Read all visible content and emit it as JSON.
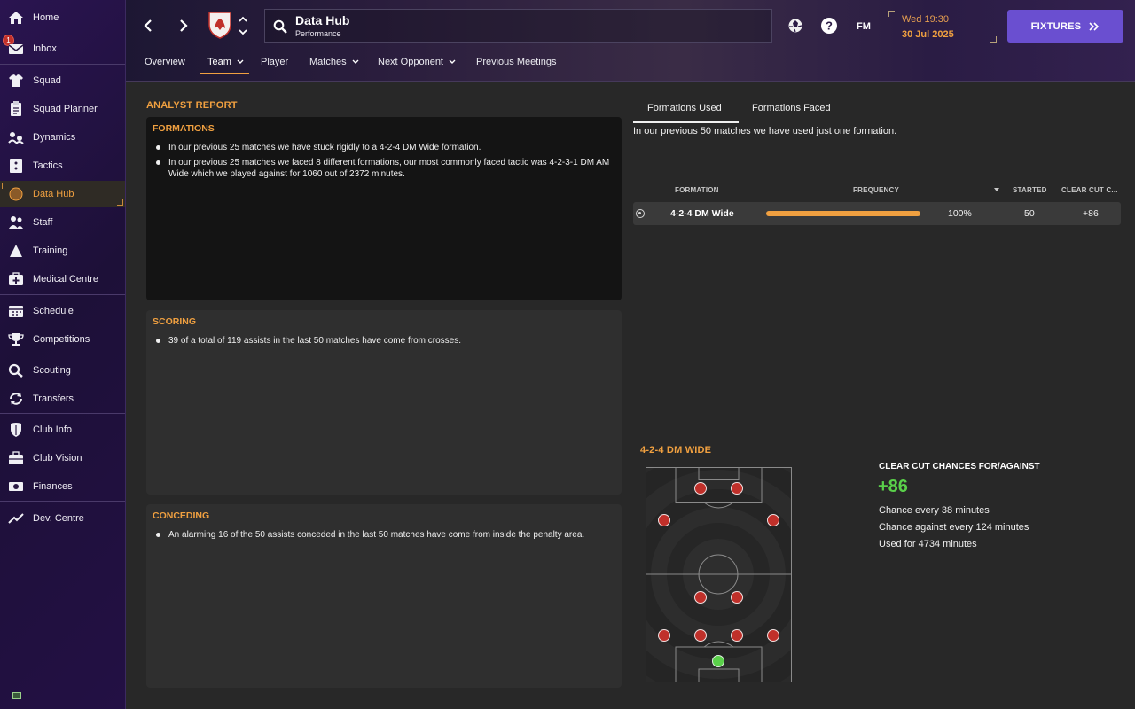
{
  "sidebar": {
    "items": [
      {
        "label": "Home",
        "icon": "home-icon"
      },
      {
        "label": "Inbox",
        "icon": "inbox-icon",
        "badge": "1"
      },
      {
        "label": "Squad",
        "icon": "squad-icon"
      },
      {
        "label": "Squad Planner",
        "icon": "squad-planner-icon"
      },
      {
        "label": "Dynamics",
        "icon": "dynamics-icon"
      },
      {
        "label": "Tactics",
        "icon": "tactics-icon"
      },
      {
        "label": "Data Hub",
        "icon": "data-hub-icon",
        "active": true
      },
      {
        "label": "Staff",
        "icon": "staff-icon"
      },
      {
        "label": "Training",
        "icon": "training-icon"
      },
      {
        "label": "Medical Centre",
        "icon": "medical-icon"
      },
      {
        "label": "Schedule",
        "icon": "schedule-icon"
      },
      {
        "label": "Competitions",
        "icon": "trophy-icon"
      },
      {
        "label": "Scouting",
        "icon": "scouting-icon"
      },
      {
        "label": "Transfers",
        "icon": "transfers-icon"
      },
      {
        "label": "Club Info",
        "icon": "club-info-icon"
      },
      {
        "label": "Club Vision",
        "icon": "club-vision-icon"
      },
      {
        "label": "Finances",
        "icon": "finances-icon"
      },
      {
        "label": "Dev. Centre",
        "icon": "dev-centre-icon"
      }
    ]
  },
  "header": {
    "title": "Data Hub",
    "subtitle": "Performance",
    "fm_label": "FM",
    "time": "Wed 19:30",
    "date": "30 Jul 2025",
    "fixtures_label": "FIXTURES",
    "tabs": [
      "Overview",
      "Team",
      "Player",
      "Matches",
      "Next Opponent",
      "Previous Meetings"
    ],
    "active_tab": "Team"
  },
  "analyst": {
    "title": "ANALYST REPORT",
    "formations": {
      "heading": "FORMATIONS",
      "bullets": [
        "In our previous 25 matches we have stuck rigidly to a 4-2-4 DM Wide formation.",
        "In our previous 25 matches we faced 8 different formations, our most commonly faced tactic was 4-2-3-1 DM AM Wide which we played against for 1060 out of 2372 minutes."
      ]
    },
    "scoring": {
      "heading": "SCORING",
      "bullets": [
        "39 of a total of 119 assists in the last 50 matches have come from crosses."
      ]
    },
    "conceding": {
      "heading": "CONCEDING",
      "bullets": [
        "An alarming 16 of the 50 assists conceded in the last 50 matches have come from inside the penalty area."
      ]
    }
  },
  "formations_panel": {
    "tabs": [
      "Formations Used",
      "Formations Faced"
    ],
    "active_tab": "Formations Used",
    "summary": "In our previous 50 matches we have used just one formation.",
    "columns": [
      "FORMATION",
      "FREQUENCY",
      "STARTED",
      "CLEAR CUT C..."
    ],
    "rows": [
      {
        "formation": "4-2-4 DM Wide",
        "frequency": "100%",
        "frequency_value": 1.0,
        "started": "50",
        "clear_cut": "+86"
      }
    ],
    "selected_title": "4-2-4 DM WIDE",
    "cc_title": "CLEAR CUT CHANCES FOR/AGAINST",
    "cc_value": "+86",
    "cc_for": "Chance every 38 minutes",
    "cc_against": "Chance against every 124 minutes",
    "used_for": "Used for 4734 minutes"
  },
  "colors": {
    "accent": "#f0a040",
    "primary_button": "#6a4fd0",
    "positive": "#5ad04a",
    "player_dot": "#c0302a"
  }
}
